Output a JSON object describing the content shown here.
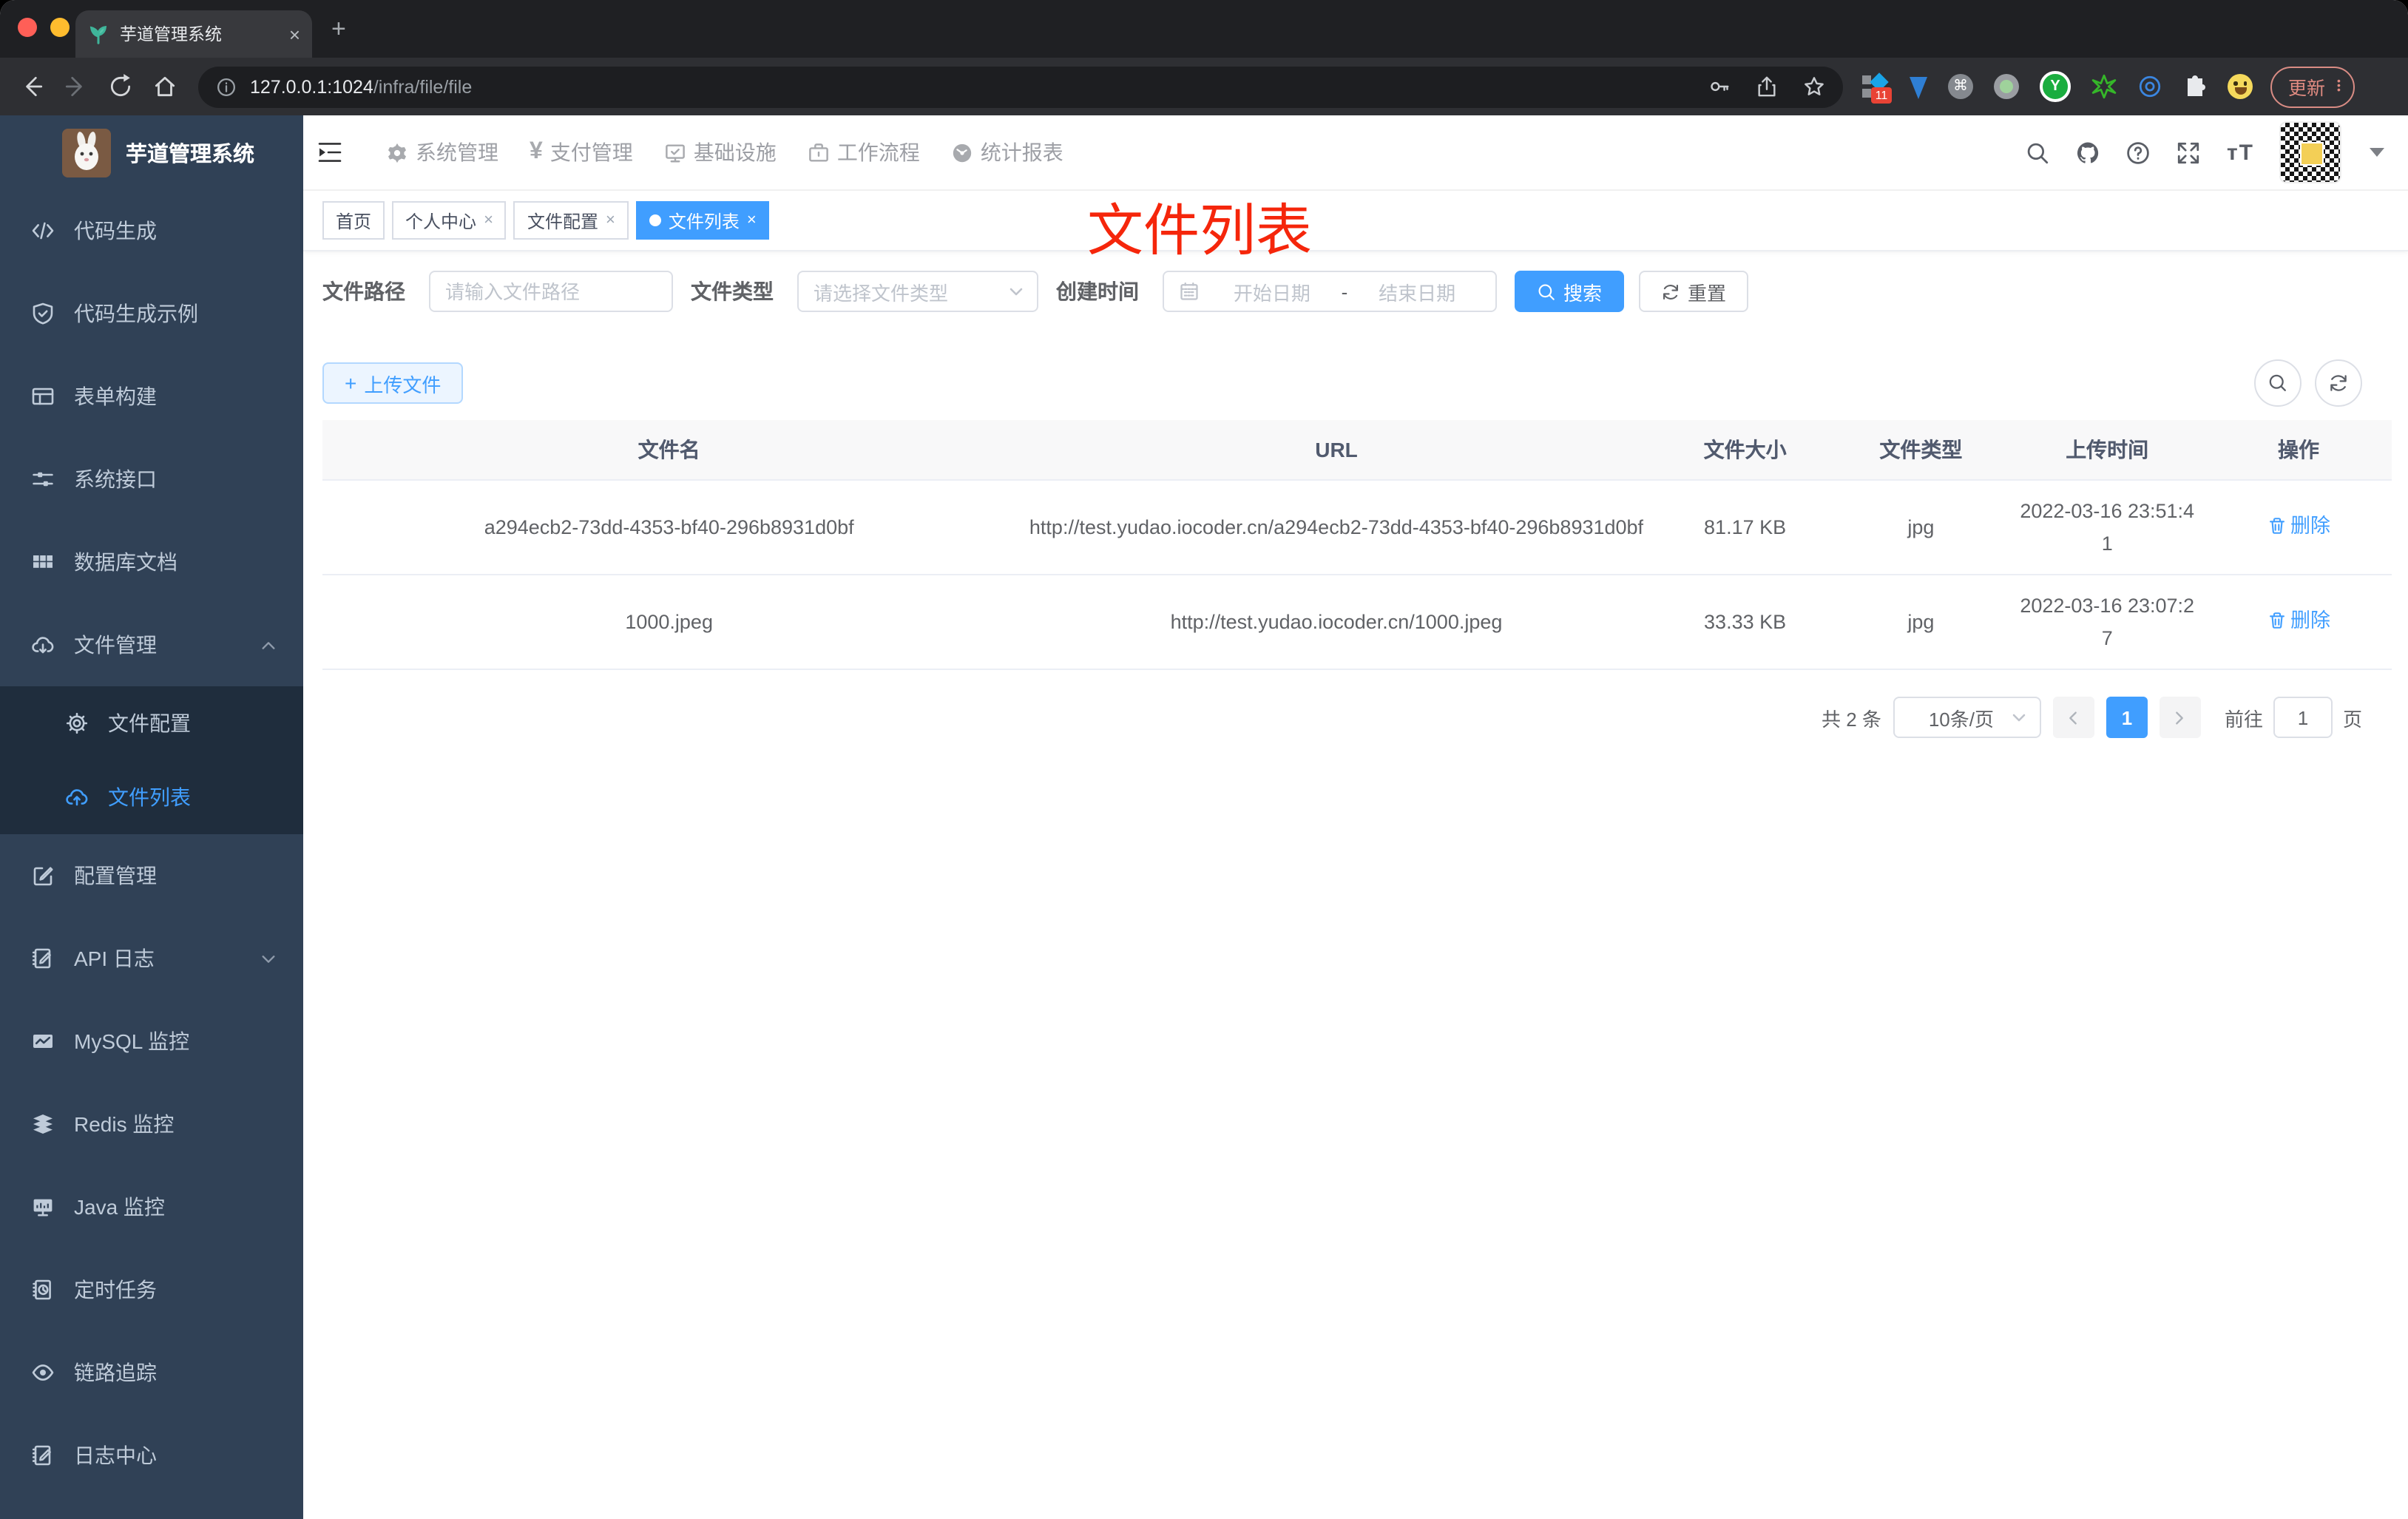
{
  "browser": {
    "tab_title": "芋道管理系统",
    "url_host": "127.0.0.1:1024",
    "url_path": "/infra/file/file",
    "extensions_badge": "11",
    "update_label": "更新"
  },
  "colors": {
    "accent": "#409eff",
    "annotation_red": "#f5260b",
    "sidebar_bg": "#304156",
    "submenu_bg": "#1f2d3d",
    "table_header_bg": "#f8f8f9"
  },
  "sidebar": {
    "title": "芋道管理系统",
    "items": [
      {
        "label": "代码生成",
        "icon": "code-icon"
      },
      {
        "label": "代码生成示例",
        "icon": "shield-check-icon"
      },
      {
        "label": "表单构建",
        "icon": "form-icon"
      },
      {
        "label": "系统接口",
        "icon": "sliders-icon"
      },
      {
        "label": "数据库文档",
        "icon": "table-grid-icon"
      },
      {
        "label": "文件管理",
        "icon": "cloud-download-icon",
        "expanded": true
      },
      {
        "label": "文件配置",
        "icon": "gear-icon",
        "submenu": true
      },
      {
        "label": "文件列表",
        "icon": "cloud-upload-icon",
        "submenu": true,
        "active": true
      },
      {
        "label": "配置管理",
        "icon": "edit-square-icon"
      },
      {
        "label": "API 日志",
        "icon": "document-pen-icon",
        "collapsed": true
      },
      {
        "label": "MySQL 监控",
        "icon": "chart-icon"
      },
      {
        "label": "Redis 监控",
        "icon": "layers-icon"
      },
      {
        "label": "Java 监控",
        "icon": "monitor-icon"
      },
      {
        "label": "定时任务",
        "icon": "schedule-icon"
      },
      {
        "label": "链路追踪",
        "icon": "eye-icon"
      },
      {
        "label": "日志中心",
        "icon": "log-pen-icon"
      }
    ]
  },
  "topnav": {
    "items": [
      {
        "label": "系统管理",
        "icon": "gear-icon"
      },
      {
        "label": "支付管理",
        "icon": "yen-icon"
      },
      {
        "label": "基础设施",
        "icon": "monitor-check-icon"
      },
      {
        "label": "工作流程",
        "icon": "briefcase-icon"
      },
      {
        "label": "统计报表",
        "icon": "dashboard-icon"
      }
    ]
  },
  "tags": {
    "items": [
      {
        "label": "首页",
        "closable": false,
        "active": false
      },
      {
        "label": "个人中心",
        "closable": true,
        "active": false
      },
      {
        "label": "文件配置",
        "closable": true,
        "active": false
      },
      {
        "label": "文件列表",
        "closable": true,
        "active": true
      }
    ]
  },
  "annotation": {
    "text": "文件列表"
  },
  "filter": {
    "path_label": "文件路径",
    "path_placeholder": "请输入文件路径",
    "type_label": "文件类型",
    "type_placeholder": "请选择文件类型",
    "date_label": "创建时间",
    "date_start": "开始日期",
    "date_separator": "-",
    "date_end": "结束日期",
    "search_label": "搜索",
    "reset_label": "重置"
  },
  "toolbar": {
    "upload_label": "上传文件"
  },
  "table": {
    "headers": [
      "文件名",
      "URL",
      "文件大小",
      "文件类型",
      "上传时间",
      "操作"
    ],
    "rows": [
      {
        "name": "a294ecb2-73dd-4353-bf40-296b8931d0bf",
        "url": "http://test.yudao.iocoder.cn/a294ecb2-73dd-4353-bf40-296b8931d0bf",
        "size": "81.17 KB",
        "type": "jpg",
        "time": "2022-03-16 23:51:41",
        "action": "删除"
      },
      {
        "name": "1000.jpeg",
        "url": "http://test.yudao.iocoder.cn/1000.jpeg",
        "size": "33.33 KB",
        "type": "jpg",
        "time": "2022-03-16 23:07:27",
        "action": "删除"
      }
    ]
  },
  "pagination": {
    "total": "共 2 条",
    "page_size": "10条/页",
    "page": "1",
    "goto_label": "前往",
    "goto_value": "1",
    "unit_label": "页"
  }
}
